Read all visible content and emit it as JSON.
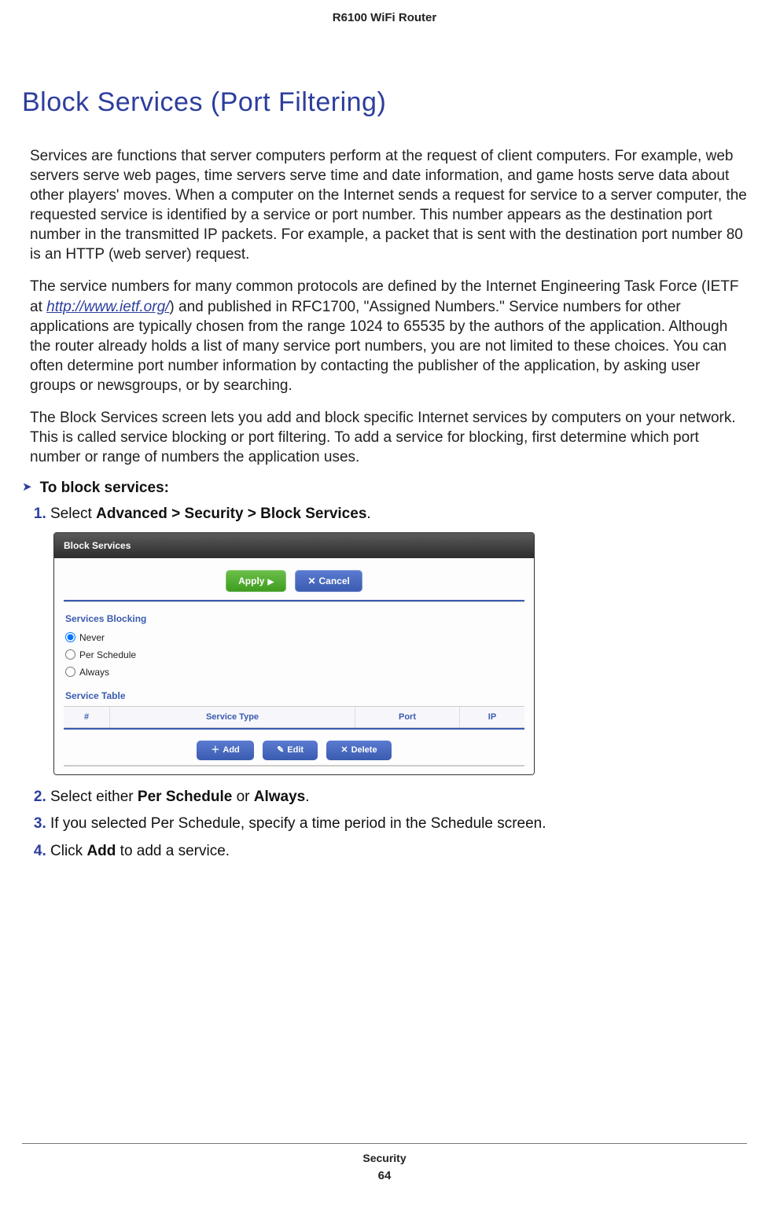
{
  "running_head": "R6100 WiFi Router",
  "section_title": "Block Services (Port Filtering)",
  "para1": "Services are functions that server computers perform at the request of client computers. For example, web servers serve web pages, time servers serve time and date information, and game hosts serve data about other players' moves. When a computer on the Internet sends a request for service to a server computer, the requested service is identified by a service or port number. This number appears as the destination port number in the transmitted IP packets. For example, a packet that is sent with the destination port number 80 is an HTTP (web server) request.",
  "para2_a": "The service numbers for many common protocols are defined by the Internet Engineering Task Force (IETF at ",
  "para2_link": "http://www.ietf.org/",
  "para2_b": ") and published in RFC1700, \"Assigned Numbers.\" Service numbers for other applications are typically chosen from the range 1024 to 65535 by the authors of the application. Although the router already holds a list of many service port numbers, you are not limited to these choices. You can often determine port number information by contacting the publisher of the application, by asking user groups or newsgroups, or by searching.",
  "para3": "The Block Services screen lets you add and block specific Internet services by computers on your network. This is called service blocking or port filtering. To add a service for blocking, first determine which port number or range of numbers the application uses.",
  "proc_label": "To block services:",
  "steps": {
    "s1_a": "Select ",
    "s1_b": "Advanced > Security > Block Services",
    "s1_c": ".",
    "s2_a": "Select either ",
    "s2_b": "Per Schedule",
    "s2_c": " or ",
    "s2_d": "Always",
    "s2_e": ".",
    "s3": "If you selected Per Schedule, specify a time period in the Schedule screen.",
    "s4_a": "Click ",
    "s4_b": "Add",
    "s4_c": " to add a service."
  },
  "shot": {
    "title": "Block Services",
    "apply": "Apply",
    "cancel": "Cancel",
    "services_blocking": "Services Blocking",
    "opt_never": "Never",
    "opt_per_schedule": "Per Schedule",
    "opt_always": "Always",
    "service_table": "Service Table",
    "col_num": "#",
    "col_type": "Service Type",
    "col_port": "Port",
    "col_ip": "IP",
    "add": "Add",
    "edit": "Edit",
    "delete": "Delete"
  },
  "footer": {
    "section": "Security",
    "page": "64"
  }
}
